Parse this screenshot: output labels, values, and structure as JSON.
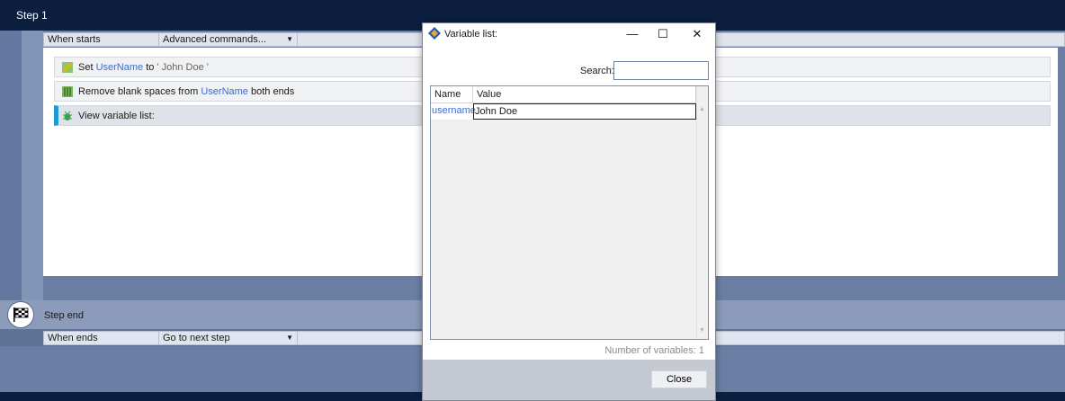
{
  "step": {
    "title": "Step 1"
  },
  "when_starts": {
    "label": "When starts",
    "dropdown": "Advanced commands..."
  },
  "commands": [
    {
      "verb": "Set",
      "var": "UserName",
      "mid": "to",
      "literal": "' John Doe '"
    },
    {
      "verb": "Remove blank spaces from",
      "var": "UserName",
      "tail": "both ends"
    },
    {
      "verb": "View variable list:"
    }
  ],
  "step_end": {
    "label": "Step end"
  },
  "when_ends": {
    "label": "When ends",
    "dropdown": "Go to next step"
  },
  "dialog": {
    "title": "Variable list:",
    "search_label": "Search:",
    "search_value": "",
    "columns": [
      "Name",
      "Value"
    ],
    "rows": [
      {
        "name": "username",
        "value": "John Doe"
      }
    ],
    "count_text": "Number of variables: 1",
    "close_label": "Close"
  },
  "colors": {
    "header_bg": "#0c1f3f",
    "accent": "#1e9ad8",
    "variable": "#3b6bd6"
  }
}
